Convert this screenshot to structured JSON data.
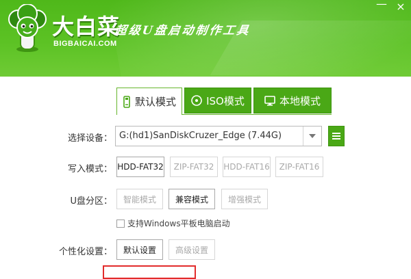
{
  "header": {
    "brand_name": "大白菜",
    "brand_domain": "BIGBAICAI.COM",
    "slogan": "超级U盘启动制作工具",
    "minimize_symbol": "—",
    "close_symbol": "×"
  },
  "tabs": [
    {
      "label": "默认模式",
      "icon": "usb-drive-icon",
      "active": true
    },
    {
      "label": "ISO模式",
      "icon": "disc-icon",
      "active": false
    },
    {
      "label": "本地模式",
      "icon": "monitor-icon",
      "active": false
    }
  ],
  "device": {
    "label": "选择设备：",
    "value": "G:(hd1)SanDiskCruzer_Edge (7.44G)"
  },
  "write_mode": {
    "label": "写入模式：",
    "options": [
      "HDD-FAT32",
      "ZIP-FAT32",
      "HDD-FAT16",
      "ZIP-FAT16"
    ],
    "selected": "HDD-FAT32"
  },
  "partition": {
    "label": "U盘分区：",
    "options": [
      "智能模式",
      "兼容模式",
      "增强模式"
    ],
    "selected": "兼容模式"
  },
  "tablet_boot": {
    "label": "支持Windows平板电脑启动",
    "checked": false
  },
  "personalize": {
    "label": "个性化设置：",
    "options": [
      "默认设置",
      "高级设置"
    ],
    "selected": "默认设置"
  },
  "colors": {
    "brand_green": "#4aa816",
    "highlight_red": "#e22b2b"
  }
}
